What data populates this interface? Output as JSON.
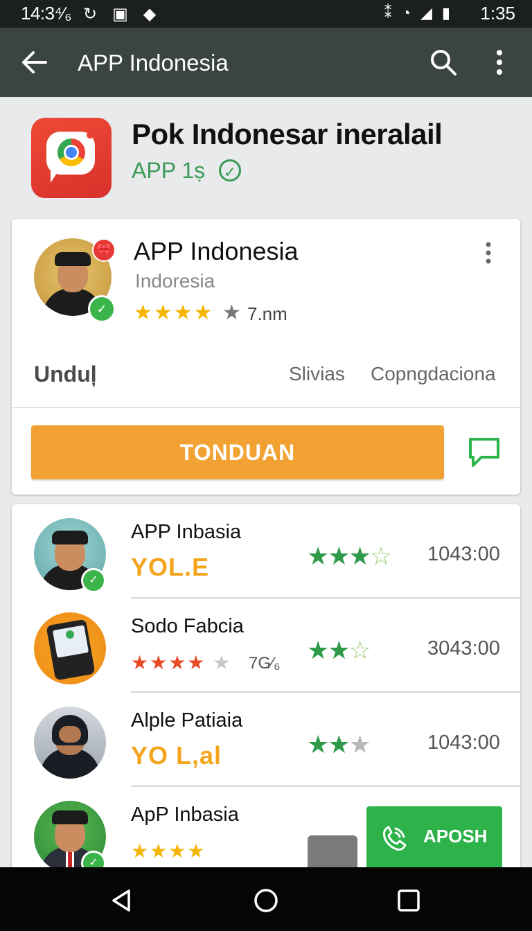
{
  "status_bar": {
    "time": "14:3⁴⁄₆",
    "clock": "1:35",
    "icons": [
      "sync-icon",
      "sim-icon",
      "dot-icon",
      "vibrate-icon",
      "wifi-icon",
      "signal-icon",
      "battery-icon"
    ]
  },
  "app_bar": {
    "title": "APP Indonesia"
  },
  "header": {
    "title": "Pok Indonesar ineralail",
    "subtitle": "APP 1ṣ",
    "check": "✓"
  },
  "card": {
    "name": "APP Indonesia",
    "subtitle": "Indoresia",
    "stars": "★★★★",
    "partial_star": "★",
    "rating_count": "7.nm",
    "badge_top": "🎀",
    "badge_bottom": "✓",
    "tabs": [
      "Unduļ",
      "Slivias",
      "Copngdaciona"
    ],
    "button_label": "TONDUAN"
  },
  "list": [
    {
      "name": "APP Inbasia",
      "tag": "YOL.E",
      "stars_full": "★★★",
      "stars_empty": "☆",
      "value": "1043:00"
    },
    {
      "name": "Sodo Fabcia",
      "small_stars": "★★★★",
      "small_empty": "★",
      "percent": "7G⁄₆",
      "stars_full": "★★",
      "stars_empty": "☆",
      "value": "3043:00"
    },
    {
      "name": "Alple Patiaia",
      "tag": "YO L,al",
      "stars_full": "★★",
      "stars_empty": "★",
      "value": "1043:00"
    },
    {
      "name": "ApP Inbasia",
      "small_stars": "★★★★"
    }
  ],
  "install_button": {
    "label": "APOSH"
  },
  "colors": {
    "app_bar": "#3a4543",
    "accent_orange": "#f2a233",
    "accent_green": "#2db34a",
    "star_yellow": "#f4b400"
  }
}
